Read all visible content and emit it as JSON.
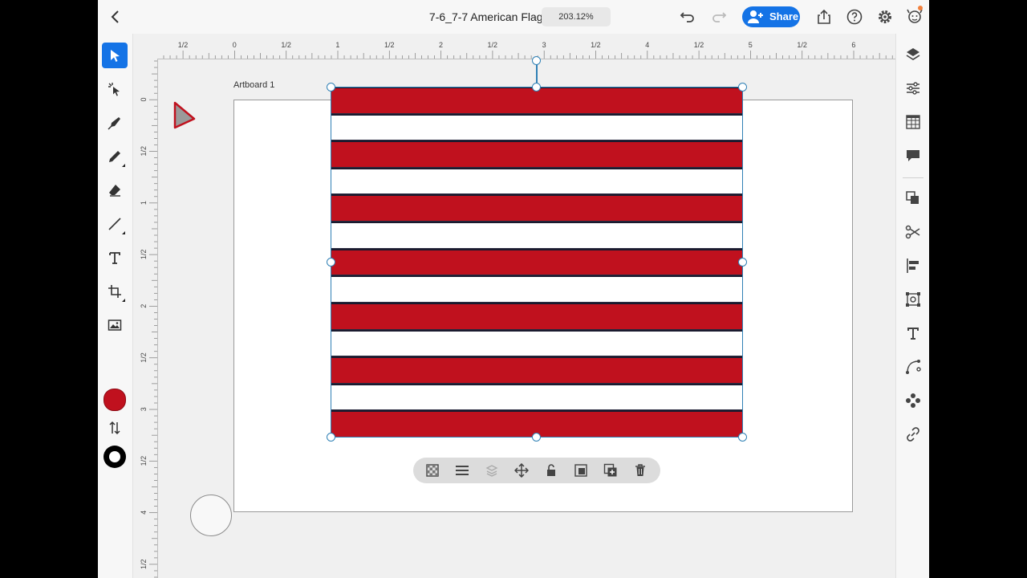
{
  "header": {
    "title": "7-6_7-7 American Flag*",
    "zoom": "203.12%",
    "share_label": "Share"
  },
  "ruler": {
    "horizontal": [
      "1/2",
      "0",
      "1/2",
      "1",
      "1/2",
      "2",
      "1/2",
      "3",
      "1/2",
      "4",
      "1/2",
      "5",
      "1/2",
      "6"
    ],
    "vertical": [
      "0",
      "1/2",
      "1",
      "1/2",
      "2",
      "1/2",
      "3",
      "1/2",
      "4",
      "1/2"
    ]
  },
  "canvas": {
    "artboard_label": "Artboard 1",
    "flag": {
      "stripe_count": 13,
      "red_color": "#c0111e",
      "white_color": "#ffffff"
    }
  },
  "colors": {
    "accent": "#1473e6",
    "fill": "#c0111e",
    "stroke": "#000000",
    "selection": "#2f80b5"
  },
  "left_tools": [
    {
      "name": "select-tool",
      "icon": "arrow-icon"
    },
    {
      "name": "direct-select-tool",
      "icon": "magic-select-icon"
    },
    {
      "name": "pen-tool",
      "icon": "pen-icon"
    },
    {
      "name": "pencil-tool",
      "icon": "pencil-icon"
    },
    {
      "name": "eraser-tool",
      "icon": "eraser-icon"
    },
    {
      "name": "line-tool",
      "icon": "line-icon"
    },
    {
      "name": "type-tool",
      "icon": "type-icon"
    },
    {
      "name": "crop-tool",
      "icon": "crop-icon"
    },
    {
      "name": "place-image-tool",
      "icon": "image-icon"
    }
  ],
  "context_tools": [
    "transparency-icon",
    "align-icon",
    "arrange-icon",
    "move-icon",
    "lock-icon",
    "mask-icon",
    "duplicate-icon",
    "delete-icon"
  ],
  "right_panel": [
    "layers-icon",
    "properties-icon",
    "libraries-icon",
    "comments-icon",
    "arrange-icon",
    "cut-icon",
    "align-icon",
    "transform-icon",
    "type-icon",
    "path-icon",
    "repeat-icon",
    "link-icon"
  ]
}
